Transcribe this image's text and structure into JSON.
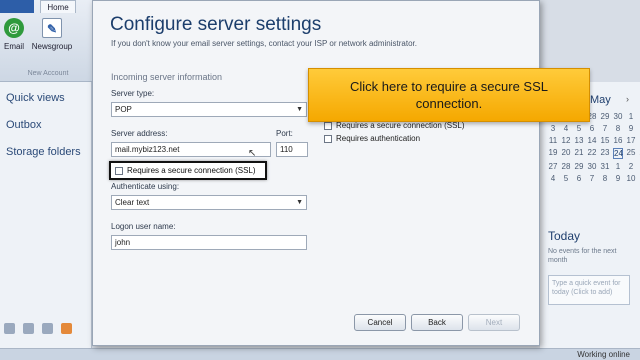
{
  "ribbon": {
    "file_tab": "",
    "home_tab": "Home",
    "email_label": "Email",
    "newsgroup_label": "Newsgroup",
    "group_caption": "New Account"
  },
  "left_nav": {
    "items": [
      "Quick views",
      "Outbox",
      "Storage folders"
    ]
  },
  "calendar": {
    "month": "May",
    "days": [
      "25",
      "26",
      "27",
      "28",
      "29",
      "30",
      "1",
      "2",
      "3",
      "4",
      "5",
      "6",
      "7",
      "8",
      "9",
      "10",
      "11",
      "12",
      "13",
      "14",
      "15",
      "16",
      "17",
      "18",
      "19",
      "20",
      "21",
      "22",
      "23",
      "24",
      "25",
      "26",
      "27",
      "28",
      "29",
      "30",
      "31",
      "1",
      "2",
      "3",
      "4",
      "5",
      "6",
      "7",
      "8",
      "9",
      "10",
      "11"
    ],
    "selected_day_index": 29,
    "today_title": "Today",
    "today_text": "No events for the next month",
    "task_placeholder": "Type a quick event for today (Click to add)"
  },
  "dialog": {
    "title": "Configure server settings",
    "subtitle": "If you don't know your email server settings, contact your ISP or network administrator.",
    "section_title": "Incoming server information",
    "server_type_label": "Server type:",
    "server_type_value": "POP",
    "server_address_label": "Server address:",
    "server_address_value": "mail.mybiz123.net",
    "port_label": "Port:",
    "port_value": "110",
    "ssl_label": "Requires a secure connection (SSL)",
    "auth_label": "Authenticate using:",
    "auth_value": "Clear text",
    "logon_label": "Logon user name:",
    "logon_value": "john",
    "outgoing_ssl_label": "Requires a secure connection (SSL)",
    "outgoing_auth_label": "Requires authentication",
    "buttons": {
      "cancel": "Cancel",
      "back": "Back",
      "next": "Next"
    }
  },
  "callout": {
    "text": "Click here to require a secure SSL connection."
  },
  "status": {
    "text": "Working online"
  },
  "colors": {
    "callout": "#f9b814",
    "title": "#1c3e6c"
  }
}
